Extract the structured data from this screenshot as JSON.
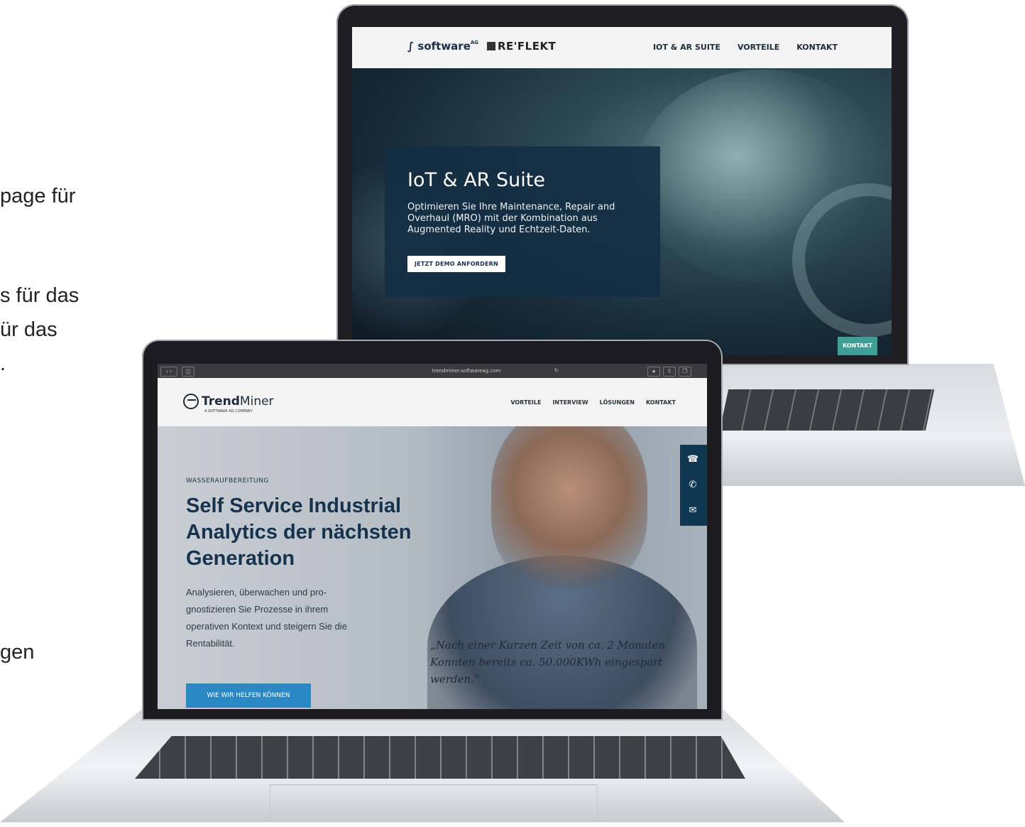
{
  "left_fragments": [
    "page für",
    "s für das",
    "ür das",
    ".",
    "gen"
  ],
  "back_site": {
    "logo_software": "software",
    "logo_software_sup": "AG",
    "logo_reflekt": "RE'FLEKT",
    "nav": [
      "IOT & AR SUITE",
      "VORTEILE",
      "KONTAKT"
    ],
    "hero_title": "IoT & AR Suite",
    "hero_desc": "Optimieren Sie Ihre Maintenance, Repair and Overhaul (MRO) mit der Kombination aus Augmented Reality und Echtzeit-Daten.",
    "demo_button": "JETZT DEMO ANFORDERN",
    "kontakt_button": "KONTAKT"
  },
  "front_site": {
    "url": "trendminer.softwareag.com",
    "logo_name_bold": "Trend",
    "logo_name_light": "Miner",
    "logo_tagline": "A SOFTWARE AG COMPANY",
    "nav": [
      "VORTEILE",
      "INTERVIEW",
      "LÖSUNGEN",
      "KONTAKT"
    ],
    "eyebrow": "WASSERAUFBEREITUNG",
    "headline": "Self Service Industrial Analytics der nächsten Generation",
    "body": "Analysieren, überwachen und pro-gnostizieren Sie Prozesse in ihrem operativen Kontext und steigern Sie die Rentabilität.",
    "cta": "WIE WIR HELFEN KÖNNEN",
    "quote": "„Nach einer Kurzen Zeit von ca. 2 Monaten Konnten bereits ca. 50.000KWh eingespart werden.“",
    "side_icons": [
      "headset-icon",
      "phone-icon",
      "mail-icon"
    ]
  },
  "colors": {
    "tm_headline": "#17324d",
    "tm_cta": "#2a88c2",
    "reflekt_kontakt": "#3f9e96",
    "hero_box": "#122c42"
  }
}
